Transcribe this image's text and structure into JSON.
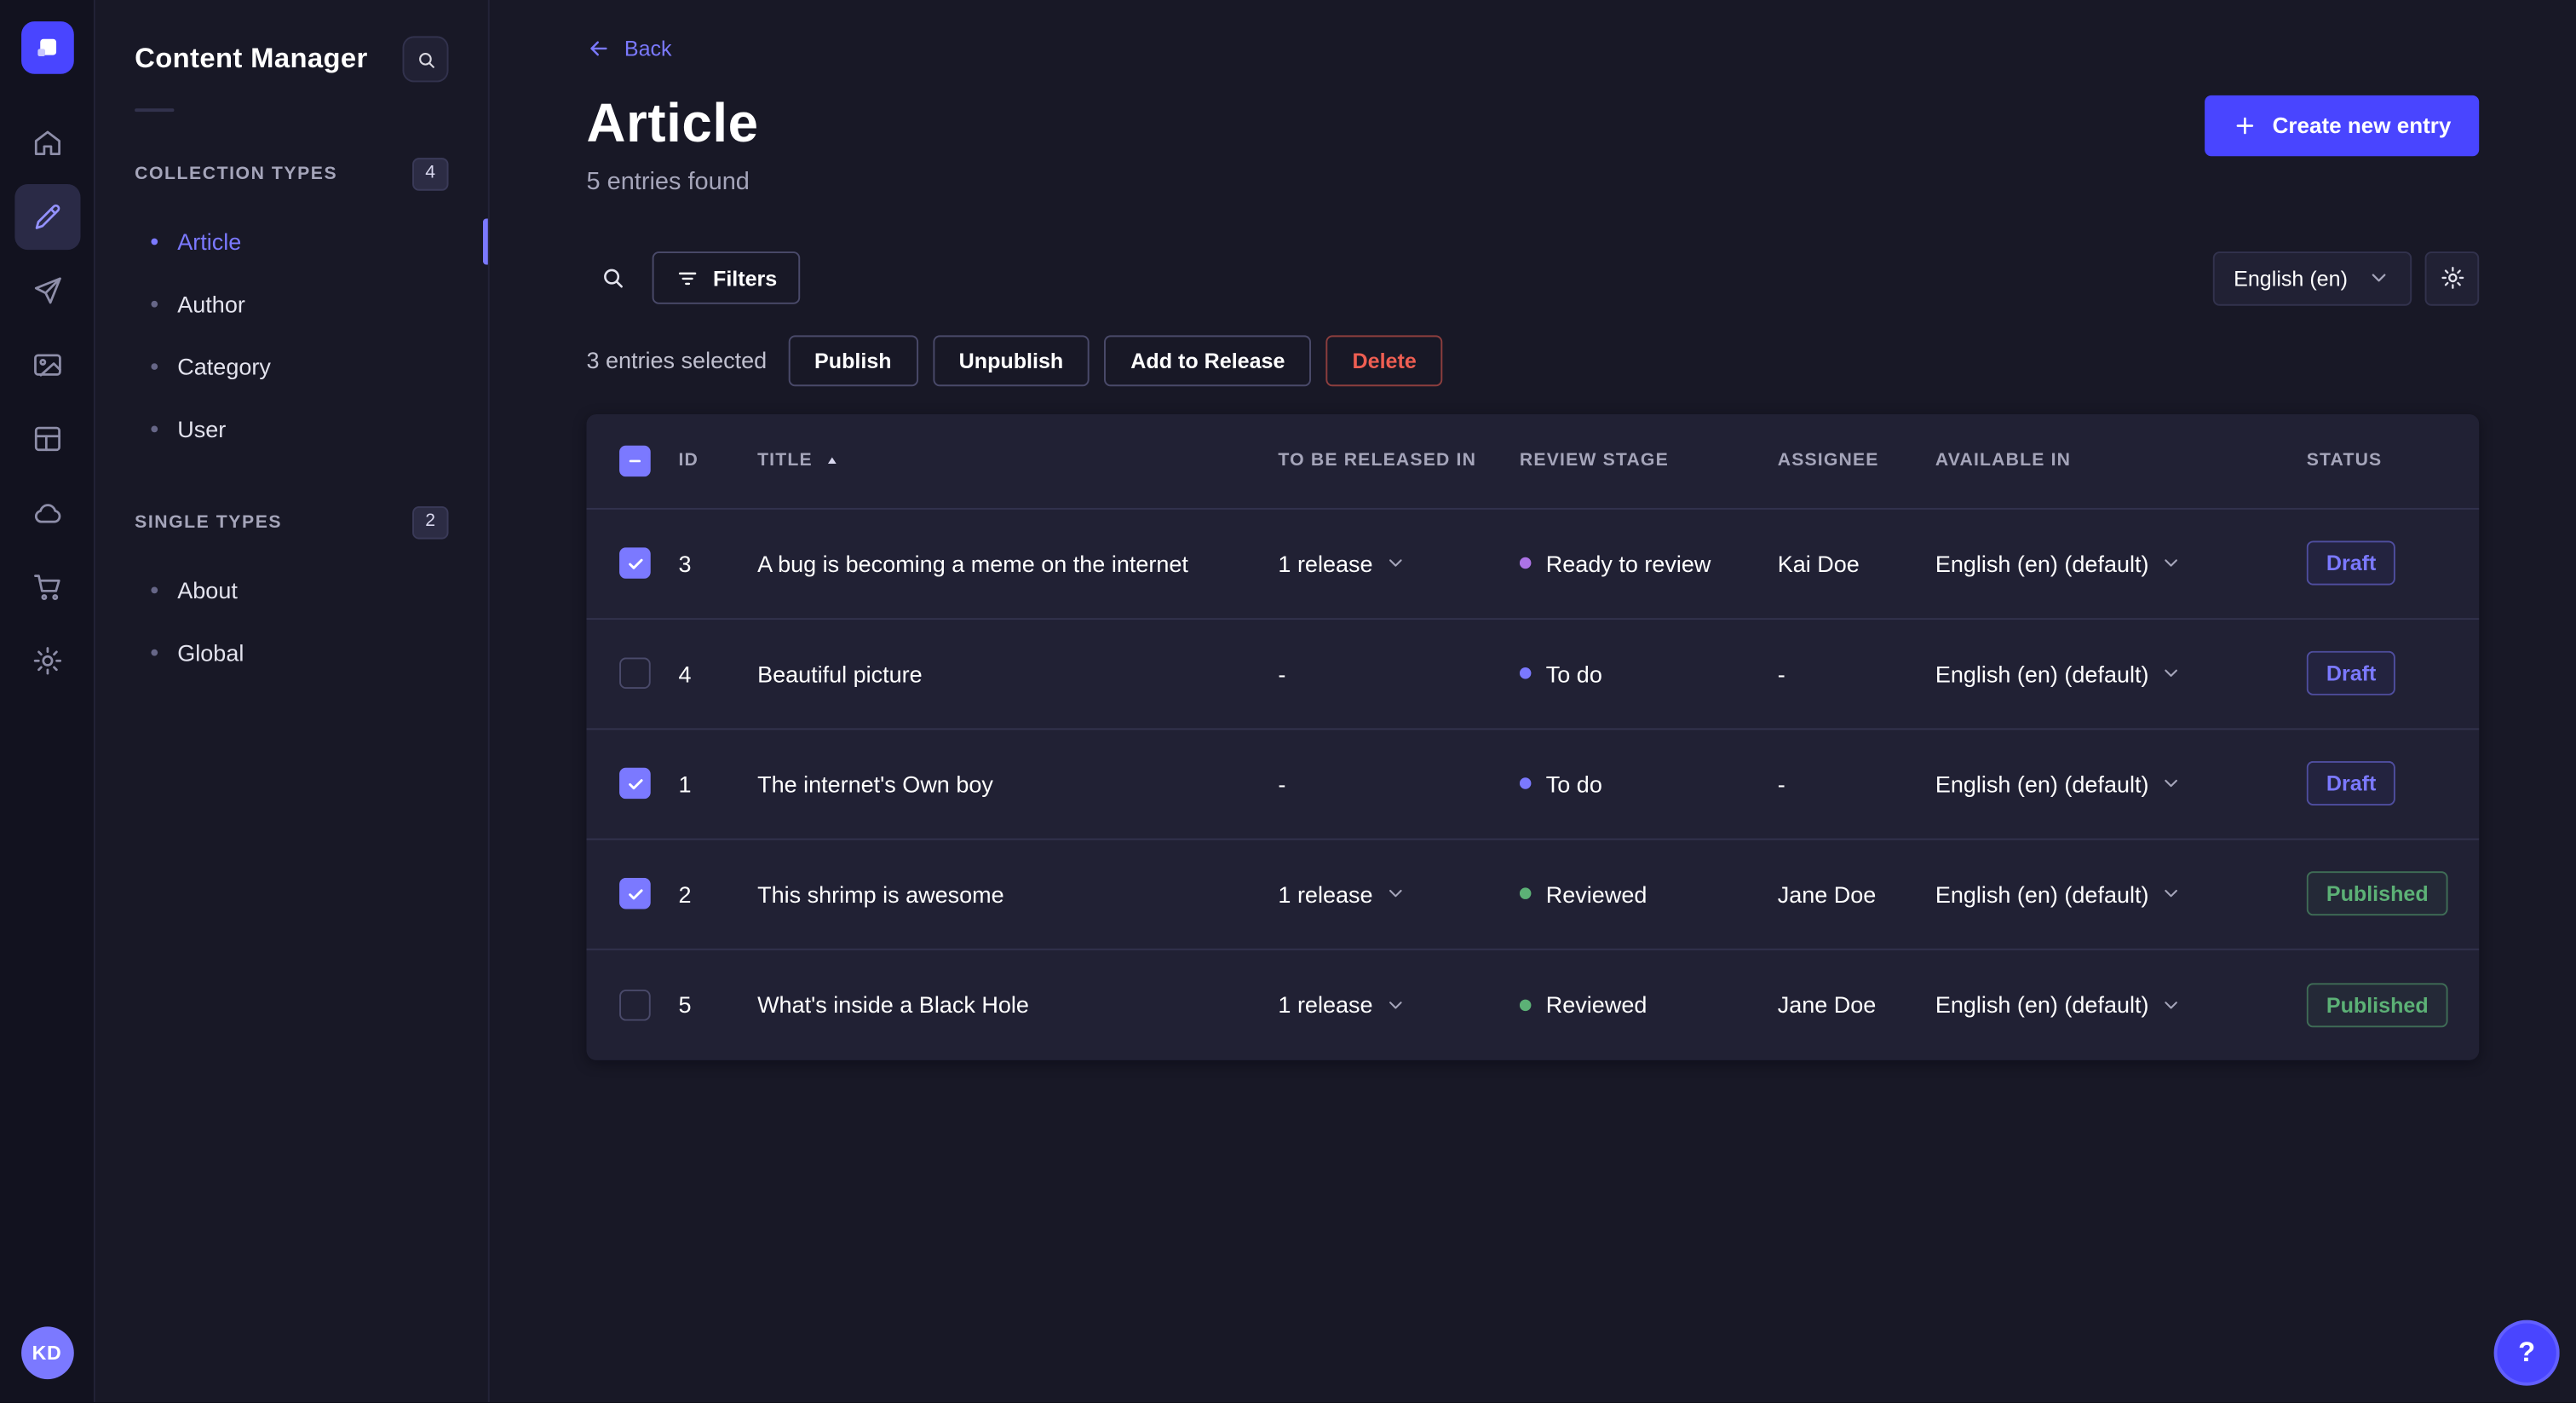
{
  "colors": {
    "primary": "#4945ff",
    "primary_light": "#7b79ff",
    "success": "#5cb176",
    "danger": "#ee5e52",
    "surface": "#212134",
    "background": "#181826"
  },
  "nav_rail": {
    "items": [
      {
        "name": "home-icon",
        "active": false
      },
      {
        "name": "content-manager-icon",
        "active": true
      },
      {
        "name": "releases-icon",
        "active": false
      },
      {
        "name": "media-library-icon",
        "active": false
      },
      {
        "name": "content-type-builder-icon",
        "active": false
      },
      {
        "name": "deploy-cloud-icon",
        "active": false
      },
      {
        "name": "marketplace-icon",
        "active": false
      },
      {
        "name": "settings-icon",
        "active": false
      }
    ],
    "avatar_initials": "KD"
  },
  "subnav": {
    "title": "Content Manager",
    "sections": [
      {
        "label": "COLLECTION TYPES",
        "badge": "4",
        "items": [
          {
            "label": "Article",
            "active": true
          },
          {
            "label": "Author",
            "active": false
          },
          {
            "label": "Category",
            "active": false
          },
          {
            "label": "User",
            "active": false
          }
        ]
      },
      {
        "label": "SINGLE TYPES",
        "badge": "2",
        "items": [
          {
            "label": "About",
            "active": false
          },
          {
            "label": "Global",
            "active": false
          }
        ]
      }
    ]
  },
  "header": {
    "back_label": "Back",
    "title": "Article",
    "subtitle": "5 entries found",
    "create_button_label": "Create new entry"
  },
  "toolbar": {
    "filters_label": "Filters",
    "locale_value": "English (en)"
  },
  "selection": {
    "text": "3 entries selected",
    "actions": [
      {
        "label": "Publish",
        "name": "publish-button",
        "variant": "default"
      },
      {
        "label": "Unpublish",
        "name": "unpublish-button",
        "variant": "default"
      },
      {
        "label": "Add to Release",
        "name": "add-to-release-button",
        "variant": "default"
      },
      {
        "label": "Delete",
        "name": "delete-button",
        "variant": "danger"
      }
    ]
  },
  "table": {
    "columns": [
      "ID",
      "TITLE",
      "TO BE RELEASED IN",
      "REVIEW STAGE",
      "ASSIGNEE",
      "AVAILABLE IN",
      "STATUS"
    ],
    "sorted_column": "TITLE",
    "sort_direction": "asc",
    "header_checkbox_state": "indeterminate",
    "rows": [
      {
        "checked": true,
        "id": "3",
        "title": "A bug is becoming a meme on the internet",
        "release": "1 release",
        "has_release_menu": true,
        "stage": "Ready to review",
        "stage_color": "#ac73e6",
        "assignee": "Kai Doe",
        "locale": "English (en) (default)",
        "status": "Draft",
        "status_variant": "draft"
      },
      {
        "checked": false,
        "id": "4",
        "title": "Beautiful picture",
        "release": "-",
        "has_release_menu": false,
        "stage": "To do",
        "stage_color": "#7b79ff",
        "assignee": "-",
        "locale": "English (en) (default)",
        "status": "Draft",
        "status_variant": "draft"
      },
      {
        "checked": true,
        "id": "1",
        "title": "The internet's Own boy",
        "release": "-",
        "has_release_menu": false,
        "stage": "To do",
        "stage_color": "#7b79ff",
        "assignee": "-",
        "locale": "English (en) (default)",
        "status": "Draft",
        "status_variant": "draft"
      },
      {
        "checked": true,
        "id": "2",
        "title": "This shrimp is awesome",
        "release": "1 release",
        "has_release_menu": true,
        "stage": "Reviewed",
        "stage_color": "#5cb176",
        "assignee": "Jane Doe",
        "locale": "English (en) (default)",
        "status": "Published",
        "status_variant": "published"
      },
      {
        "checked": false,
        "id": "5",
        "title": "What's inside a Black Hole",
        "release": "1 release",
        "has_release_menu": true,
        "stage": "Reviewed",
        "stage_color": "#5cb176",
        "assignee": "Jane Doe",
        "locale": "English (en) (default)",
        "status": "Published",
        "status_variant": "published"
      }
    ]
  },
  "help": {
    "glyph": "?"
  }
}
